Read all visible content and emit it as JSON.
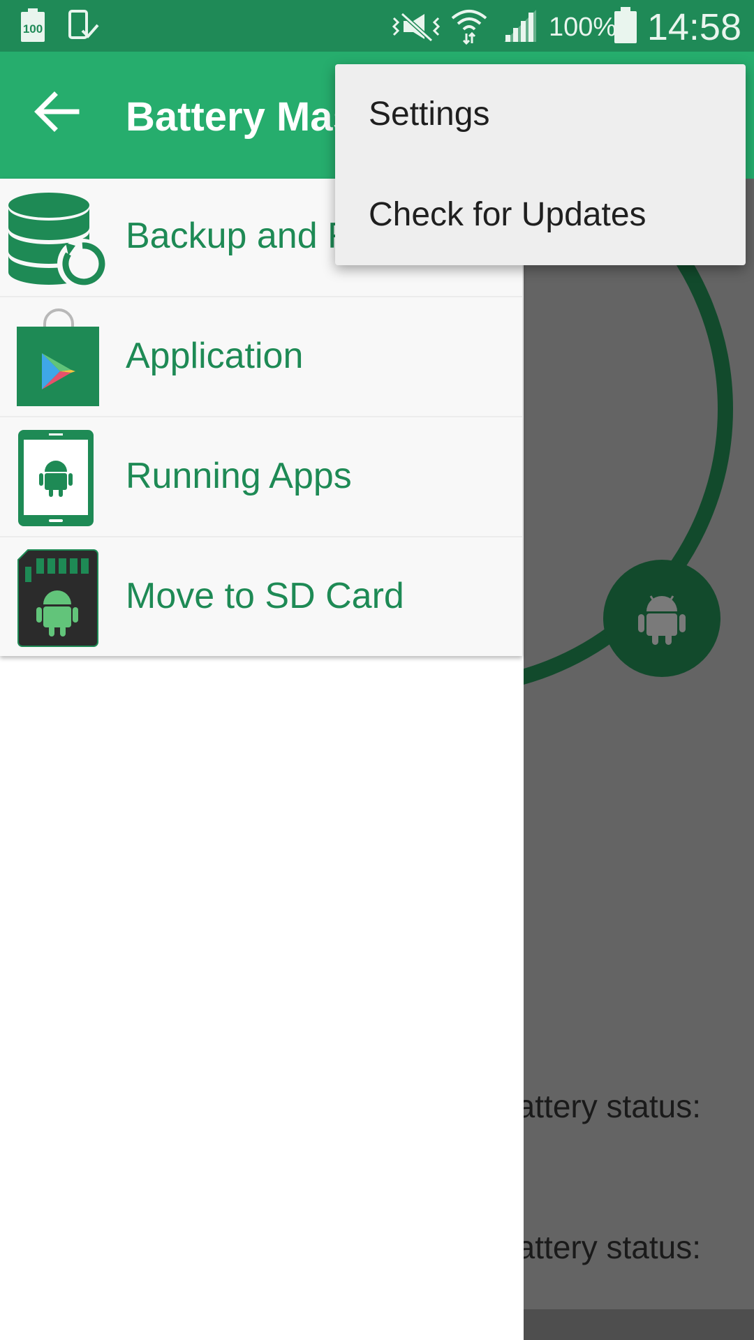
{
  "status_bar": {
    "battery_icon_label": "100",
    "battery_percent": "100%",
    "time": "14:58",
    "icons": [
      "battery-full-icon",
      "phone-check-icon",
      "vibrate-mute-icon",
      "wifi-icon",
      "signal-icon",
      "battery-icon"
    ]
  },
  "app_bar": {
    "title": "Battery Master",
    "back_icon": "arrow-back-icon"
  },
  "drawer": {
    "items": [
      {
        "label": "Backup and Restore",
        "icon": "database-restore-icon"
      },
      {
        "label": "Application",
        "icon": "play-store-bag-icon"
      },
      {
        "label": "Running Apps",
        "icon": "android-tablet-icon"
      },
      {
        "label": "Move to SD Card",
        "icon": "sd-card-android-icon"
      }
    ]
  },
  "overflow_menu": {
    "items": [
      {
        "label": "Settings"
      },
      {
        "label": "Check for Updates"
      }
    ]
  },
  "background": {
    "status_line_1": "Battery status:",
    "status_line_2": "Battery status:"
  },
  "colors": {
    "status_bar": "#1f8a57",
    "app_bar": "#26ad6d",
    "accent_text": "#1e8a55",
    "dark_green": "#124a2c",
    "scrim": "#646464"
  }
}
